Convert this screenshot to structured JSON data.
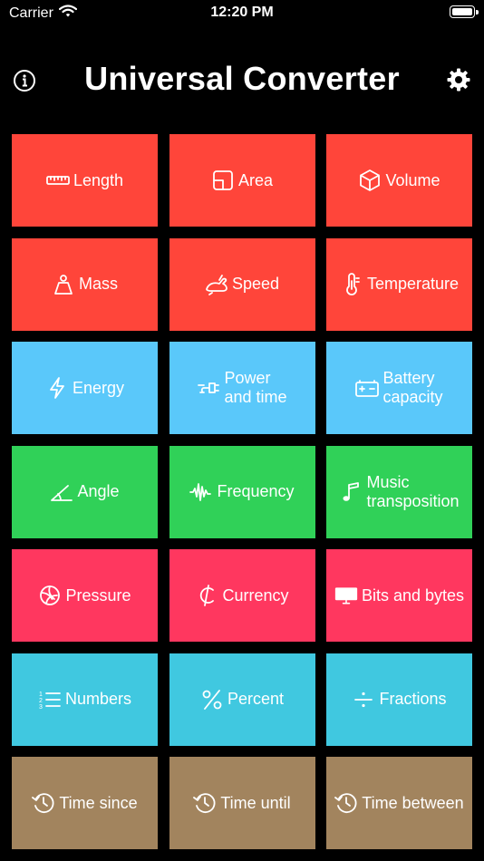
{
  "status": {
    "carrier": "Carrier",
    "time": "12:20 PM"
  },
  "header": {
    "title": "Universal Converter"
  },
  "colors": {
    "red": "#FF453A",
    "blue": "#5AC8FA",
    "green": "#30D158",
    "pink": "#FF375F",
    "teal": "#40C8E0",
    "tan": "#A2845E"
  },
  "tiles": [
    {
      "label": "Length",
      "icon": "ruler-icon",
      "color": "#FF453A"
    },
    {
      "label": "Area",
      "icon": "area-icon",
      "color": "#FF453A"
    },
    {
      "label": "Volume",
      "icon": "cube-icon",
      "color": "#FF453A"
    },
    {
      "label": "Mass",
      "icon": "weight-icon",
      "color": "#FF453A"
    },
    {
      "label": "Speed",
      "icon": "hare-icon",
      "color": "#FF453A"
    },
    {
      "label": "Temperature",
      "icon": "thermometer-icon",
      "color": "#FF453A"
    },
    {
      "label": "Energy",
      "icon": "bolt-icon",
      "color": "#5AC8FA"
    },
    {
      "label": "Power\nand time",
      "icon": "plug-icon",
      "color": "#5AC8FA"
    },
    {
      "label": "Battery\ncapacity",
      "icon": "battery-icon",
      "color": "#5AC8FA"
    },
    {
      "label": "Angle",
      "icon": "angle-icon",
      "color": "#30D158"
    },
    {
      "label": "Frequency",
      "icon": "waveform-icon",
      "color": "#30D158"
    },
    {
      "label": "Music\ntransposition",
      "icon": "music-note-icon",
      "color": "#30D158"
    },
    {
      "label": "Pressure",
      "icon": "volleyball-icon",
      "color": "#FF375F"
    },
    {
      "label": "Currency",
      "icon": "cedi-icon",
      "color": "#FF375F"
    },
    {
      "label": "Bits and bytes",
      "icon": "display-icon",
      "color": "#FF375F"
    },
    {
      "label": "Numbers",
      "icon": "numbered-list-icon",
      "color": "#40C8E0"
    },
    {
      "label": "Percent",
      "icon": "percent-icon",
      "color": "#40C8E0"
    },
    {
      "label": "Fractions",
      "icon": "divide-icon",
      "color": "#40C8E0"
    },
    {
      "label": "Time since",
      "icon": "clock-arrow-icon",
      "color": "#A2845E"
    },
    {
      "label": "Time until",
      "icon": "clock-arrow-icon",
      "color": "#A2845E"
    },
    {
      "label": "Time between",
      "icon": "clock-arrow-icon",
      "color": "#A2845E"
    }
  ]
}
